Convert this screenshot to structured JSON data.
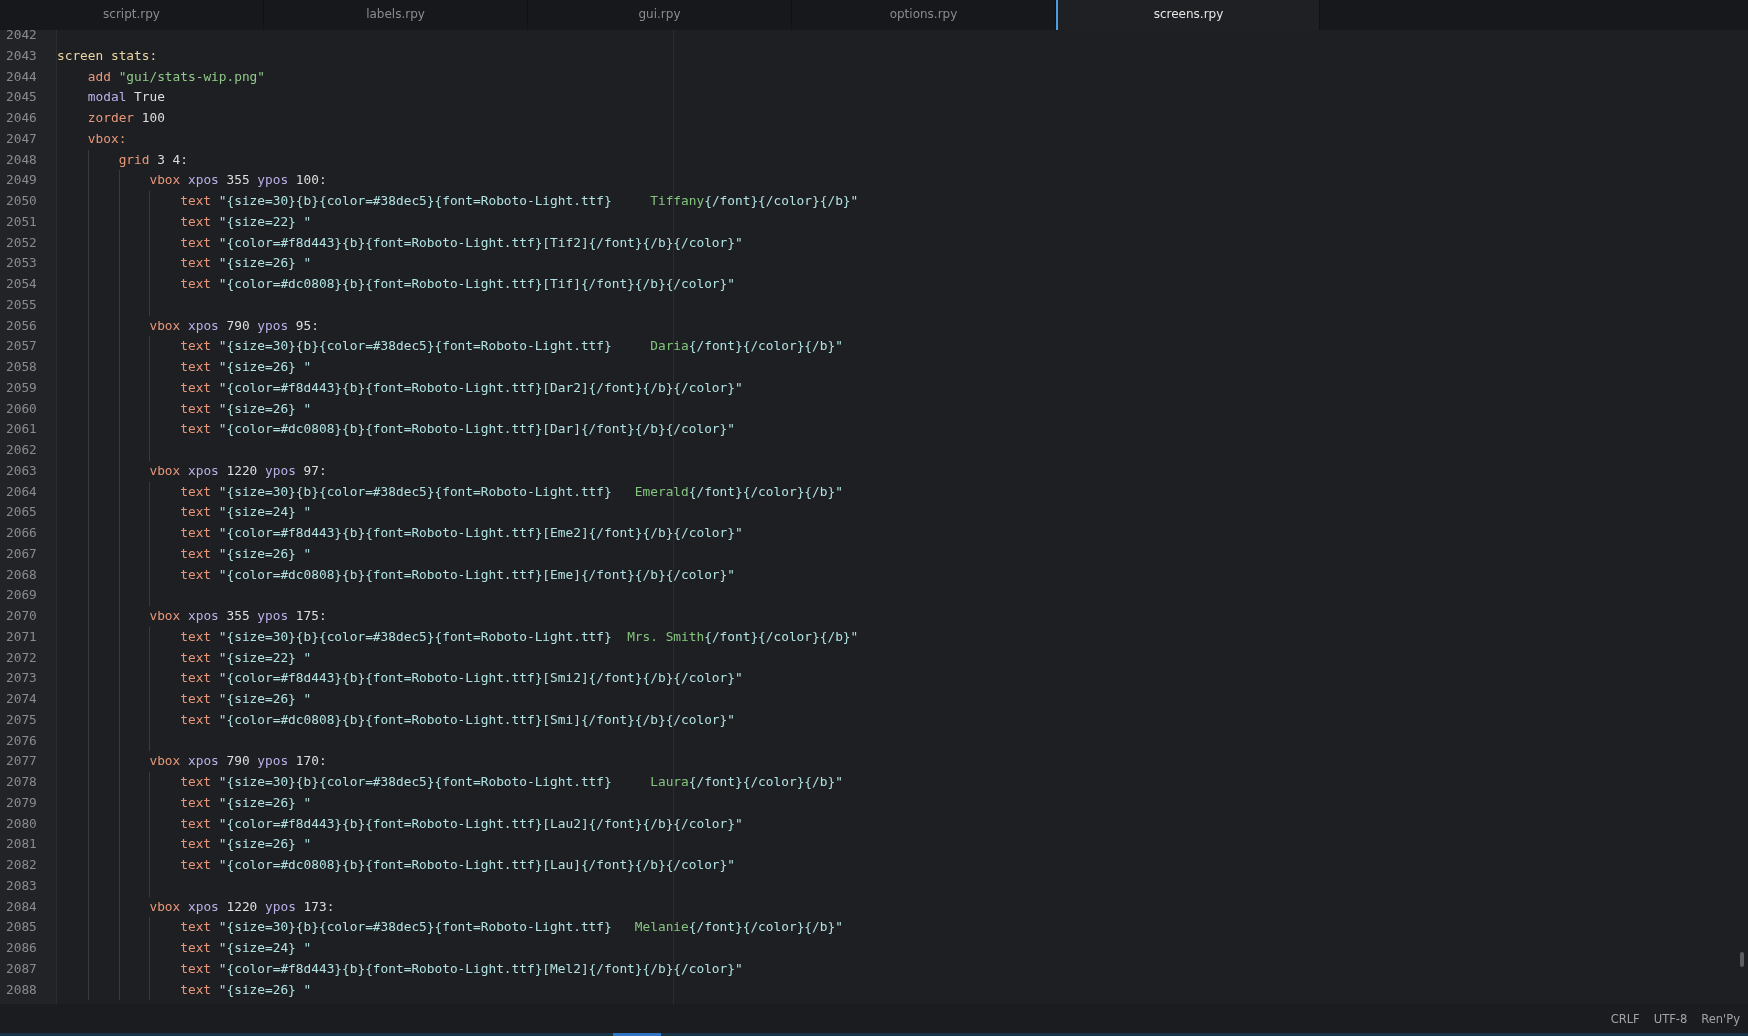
{
  "tabs": [
    {
      "label": "script.rpy",
      "selected": false
    },
    {
      "label": "labels.rpy",
      "selected": false
    },
    {
      "label": "gui.rpy",
      "selected": false
    },
    {
      "label": "options.rpy",
      "selected": false
    },
    {
      "label": "screens.rpy",
      "selected": true
    }
  ],
  "editor": {
    "lines": [
      {
        "number": "2042"
      },
      {
        "number": "2043",
        "tokens": [
          {
            "kind": "definition",
            "text": "screen stats:"
          }
        ],
        "children": [
          {
            "number": "2044",
            "tokens": [
              {
                "kind": "keyword",
                "text": "add"
              },
              {
                "kind": "string",
                "text": " \"gui/stats-wip.png\""
              }
            ]
          },
          {
            "number": "2045",
            "tokens": [
              {
                "kind": "property",
                "text": "modal"
              },
              {
                "kind": "value",
                "text": " True"
              }
            ]
          },
          {
            "number": "2046",
            "tokens": [
              {
                "kind": "keyword",
                "text": "zorder"
              },
              {
                "kind": "value",
                "text": " 100"
              }
            ]
          },
          {
            "number": "2047",
            "tokens": [
              {
                "kind": "keyword",
                "text": "vbox:"
              }
            ],
            "children": [
              {
                "number": "2048",
                "tokens": [
                  {
                    "kind": "keyword",
                    "text": "grid"
                  },
                  {
                    "kind": "value",
                    "text": " 3 4:"
                  }
                ],
                "children": [
                  {
                    "number": "2049",
                    "tokens": [
                      {
                        "kind": "keyword",
                        "text": "vbox"
                      },
                      {
                        "kind": "property",
                        "text": " xpos"
                      },
                      {
                        "kind": "value",
                        "text": " 355"
                      },
                      {
                        "kind": "property",
                        "text": " ypos"
                      },
                      {
                        "kind": "value",
                        "text": " 100:"
                      }
                    ],
                    "children": [
                      {
                        "number": "2050",
                        "tokens": [
                          {
                            "kind": "keyword",
                            "text": "text"
                          },
                          {
                            "kind": "tag",
                            "text": " \"{size=30}{b}{color=#38dec5}{font=Roboto-Light.ttf}     "
                          },
                          {
                            "kind": "name",
                            "text": "Tiffany"
                          },
                          {
                            "kind": "tag",
                            "text": "{/font}{/color}{/b}\""
                          }
                        ]
                      },
                      {
                        "number": "2051",
                        "tokens": [
                          {
                            "kind": "keyword",
                            "text": "text"
                          },
                          {
                            "kind": "tag",
                            "text": " \"{size=22} \""
                          }
                        ]
                      },
                      {
                        "number": "2052",
                        "tokens": [
                          {
                            "kind": "keyword",
                            "text": "text"
                          },
                          {
                            "kind": "tag",
                            "text": " \"{color=#f8d443}{b}{font=Roboto-Light.ttf}[Tif2]{/font}{/b}{/color}\""
                          }
                        ]
                      },
                      {
                        "number": "2053",
                        "tokens": [
                          {
                            "kind": "keyword",
                            "text": "text"
                          },
                          {
                            "kind": "tag",
                            "text": " \"{size=26} \""
                          }
                        ]
                      },
                      {
                        "number": "2054",
                        "tokens": [
                          {
                            "kind": "keyword",
                            "text": "text"
                          },
                          {
                            "kind": "tag",
                            "text": " \"{color=#dc0808}{b}{font=Roboto-Light.ttf}[Tif]{/font}{/b}{/color}\""
                          }
                        ]
                      },
                      {
                        "number": "2055"
                      }
                    ]
                  },
                  {
                    "number": "2056",
                    "tokens": [
                      {
                        "kind": "keyword",
                        "text": "vbox"
                      },
                      {
                        "kind": "property",
                        "text": " xpos"
                      },
                      {
                        "kind": "value",
                        "text": " 790"
                      },
                      {
                        "kind": "property",
                        "text": " ypos"
                      },
                      {
                        "kind": "value",
                        "text": " 95:"
                      }
                    ],
                    "children": [
                      {
                        "number": "2057",
                        "tokens": [
                          {
                            "kind": "keyword",
                            "text": "text"
                          },
                          {
                            "kind": "tag",
                            "text": " \"{size=30}{b}{color=#38dec5}{font=Roboto-Light.ttf}     "
                          },
                          {
                            "kind": "name",
                            "text": "Daria"
                          },
                          {
                            "kind": "tag",
                            "text": "{/font}{/color}{/b}\""
                          }
                        ]
                      },
                      {
                        "number": "2058",
                        "tokens": [
                          {
                            "kind": "keyword",
                            "text": "text"
                          },
                          {
                            "kind": "tag",
                            "text": " \"{size=26} \""
                          }
                        ]
                      },
                      {
                        "number": "2059",
                        "tokens": [
                          {
                            "kind": "keyword",
                            "text": "text"
                          },
                          {
                            "kind": "tag",
                            "text": " \"{color=#f8d443}{b}{font=Roboto-Light.ttf}[Dar2]{/font}{/b}{/color}\""
                          }
                        ]
                      },
                      {
                        "number": "2060",
                        "tokens": [
                          {
                            "kind": "keyword",
                            "text": "text"
                          },
                          {
                            "kind": "tag",
                            "text": " \"{size=26} \""
                          }
                        ]
                      },
                      {
                        "number": "2061",
                        "tokens": [
                          {
                            "kind": "keyword",
                            "text": "text"
                          },
                          {
                            "kind": "tag",
                            "text": " \"{color=#dc0808}{b}{font=Roboto-Light.ttf}[Dar]{/font}{/b}{/color}\""
                          }
                        ]
                      },
                      {
                        "number": "2062"
                      }
                    ]
                  },
                  {
                    "number": "2063",
                    "tokens": [
                      {
                        "kind": "keyword",
                        "text": "vbox"
                      },
                      {
                        "kind": "property",
                        "text": " xpos"
                      },
                      {
                        "kind": "value",
                        "text": " 1220"
                      },
                      {
                        "kind": "property",
                        "text": " ypos"
                      },
                      {
                        "kind": "value",
                        "text": " 97:"
                      }
                    ],
                    "children": [
                      {
                        "number": "2064",
                        "tokens": [
                          {
                            "kind": "keyword",
                            "text": "text"
                          },
                          {
                            "kind": "tag",
                            "text": " \"{size=30}{b}{color=#38dec5}{font=Roboto-Light.ttf}   "
                          },
                          {
                            "kind": "name",
                            "text": "Emerald"
                          },
                          {
                            "kind": "tag",
                            "text": "{/font}{/color}{/b}\""
                          }
                        ]
                      },
                      {
                        "number": "2065",
                        "tokens": [
                          {
                            "kind": "keyword",
                            "text": "text"
                          },
                          {
                            "kind": "tag",
                            "text": " \"{size=24} \""
                          }
                        ]
                      },
                      {
                        "number": "2066",
                        "tokens": [
                          {
                            "kind": "keyword",
                            "text": "text"
                          },
                          {
                            "kind": "tag",
                            "text": " \"{color=#f8d443}{b}{font=Roboto-Light.ttf}[Eme2]{/font}{/b}{/color}\""
                          }
                        ]
                      },
                      {
                        "number": "2067",
                        "tokens": [
                          {
                            "kind": "keyword",
                            "text": "text"
                          },
                          {
                            "kind": "tag",
                            "text": " \"{size=26} \""
                          }
                        ]
                      },
                      {
                        "number": "2068",
                        "tokens": [
                          {
                            "kind": "keyword",
                            "text": "text"
                          },
                          {
                            "kind": "tag",
                            "text": " \"{color=#dc0808}{b}{font=Roboto-Light.ttf}[Eme]{/font}{/b}{/color}\""
                          }
                        ]
                      },
                      {
                        "number": "2069"
                      }
                    ]
                  },
                  {
                    "number": "2070",
                    "tokens": [
                      {
                        "kind": "keyword",
                        "text": "vbox"
                      },
                      {
                        "kind": "property",
                        "text": " xpos"
                      },
                      {
                        "kind": "value",
                        "text": " 355"
                      },
                      {
                        "kind": "property",
                        "text": " ypos"
                      },
                      {
                        "kind": "value",
                        "text": " 175:"
                      }
                    ],
                    "children": [
                      {
                        "number": "2071",
                        "tokens": [
                          {
                            "kind": "keyword",
                            "text": "text"
                          },
                          {
                            "kind": "tag",
                            "text": " \"{size=30}{b}{color=#38dec5}{font=Roboto-Light.ttf}  "
                          },
                          {
                            "kind": "name",
                            "text": "Mrs. Smith"
                          },
                          {
                            "kind": "tag",
                            "text": "{/font}{/color}{/b}\""
                          }
                        ]
                      },
                      {
                        "number": "2072",
                        "tokens": [
                          {
                            "kind": "keyword",
                            "text": "text"
                          },
                          {
                            "kind": "tag",
                            "text": " \"{size=22} \""
                          }
                        ]
                      },
                      {
                        "number": "2073",
                        "tokens": [
                          {
                            "kind": "keyword",
                            "text": "text"
                          },
                          {
                            "kind": "tag",
                            "text": " \"{color=#f8d443}{b}{font=Roboto-Light.ttf}[Smi2]{/font}{/b}{/color}\""
                          }
                        ]
                      },
                      {
                        "number": "2074",
                        "tokens": [
                          {
                            "kind": "keyword",
                            "text": "text"
                          },
                          {
                            "kind": "tag",
                            "text": " \"{size=26} \""
                          }
                        ]
                      },
                      {
                        "number": "2075",
                        "tokens": [
                          {
                            "kind": "keyword",
                            "text": "text"
                          },
                          {
                            "kind": "tag",
                            "text": " \"{color=#dc0808}{b}{font=Roboto-Light.ttf}[Smi]{/font}{/b}{/color}\""
                          }
                        ]
                      },
                      {
                        "number": "2076"
                      }
                    ]
                  },
                  {
                    "number": "2077",
                    "tokens": [
                      {
                        "kind": "keyword",
                        "text": "vbox"
                      },
                      {
                        "kind": "property",
                        "text": " xpos"
                      },
                      {
                        "kind": "value",
                        "text": " 790"
                      },
                      {
                        "kind": "property",
                        "text": " ypos"
                      },
                      {
                        "kind": "value",
                        "text": " 170:"
                      }
                    ],
                    "children": [
                      {
                        "number": "2078",
                        "tokens": [
                          {
                            "kind": "keyword",
                            "text": "text"
                          },
                          {
                            "kind": "tag",
                            "text": " \"{size=30}{b}{color=#38dec5}{font=Roboto-Light.ttf}     "
                          },
                          {
                            "kind": "name",
                            "text": "Laura"
                          },
                          {
                            "kind": "tag",
                            "text": "{/font}{/color}{/b}\""
                          }
                        ]
                      },
                      {
                        "number": "2079",
                        "tokens": [
                          {
                            "kind": "keyword",
                            "text": "text"
                          },
                          {
                            "kind": "tag",
                            "text": " \"{size=26} \""
                          }
                        ]
                      },
                      {
                        "number": "2080",
                        "tokens": [
                          {
                            "kind": "keyword",
                            "text": "text"
                          },
                          {
                            "kind": "tag",
                            "text": " \"{color=#f8d443}{b}{font=Roboto-Light.ttf}[Lau2]{/font}{/b}{/color}\""
                          }
                        ]
                      },
                      {
                        "number": "2081",
                        "tokens": [
                          {
                            "kind": "keyword",
                            "text": "text"
                          },
                          {
                            "kind": "tag",
                            "text": " \"{size=26} \""
                          }
                        ]
                      },
                      {
                        "number": "2082",
                        "tokens": [
                          {
                            "kind": "keyword",
                            "text": "text"
                          },
                          {
                            "kind": "tag",
                            "text": " \"{color=#dc0808}{b}{font=Roboto-Light.ttf}[Lau]{/font}{/b}{/color}\""
                          }
                        ]
                      },
                      {
                        "number": "2083"
                      }
                    ]
                  },
                  {
                    "number": "2084",
                    "tokens": [
                      {
                        "kind": "keyword",
                        "text": "vbox"
                      },
                      {
                        "kind": "property",
                        "text": " xpos"
                      },
                      {
                        "kind": "value",
                        "text": " 1220"
                      },
                      {
                        "kind": "property",
                        "text": " ypos"
                      },
                      {
                        "kind": "value",
                        "text": " 173:"
                      }
                    ],
                    "children": [
                      {
                        "number": "2085",
                        "tokens": [
                          {
                            "kind": "keyword",
                            "text": "text"
                          },
                          {
                            "kind": "tag",
                            "text": " \"{size=30}{b}{color=#38dec5}{font=Roboto-Light.ttf}   "
                          },
                          {
                            "kind": "name",
                            "text": "Melanie"
                          },
                          {
                            "kind": "tag",
                            "text": "{/font}{/color}{/b}\""
                          }
                        ]
                      },
                      {
                        "number": "2086",
                        "tokens": [
                          {
                            "kind": "keyword",
                            "text": "text"
                          },
                          {
                            "kind": "tag",
                            "text": " \"{size=24} \""
                          }
                        ]
                      },
                      {
                        "number": "2087",
                        "tokens": [
                          {
                            "kind": "keyword",
                            "text": "text"
                          },
                          {
                            "kind": "tag",
                            "text": " \"{color=#f8d443}{b}{font=Roboto-Light.ttf}[Mel2]{/font}{/b}{/color}\""
                          }
                        ]
                      },
                      {
                        "number": "2088",
                        "tokens": [
                          {
                            "kind": "keyword",
                            "text": "text"
                          },
                          {
                            "kind": "tag",
                            "text": " \"{size=26} \""
                          }
                        ]
                      }
                    ]
                  }
                ]
              }
            ]
          }
        ]
      }
    ]
  },
  "status_bar": {
    "items": [
      "CRLF",
      "UTF-8",
      "Ren'Py"
    ]
  }
}
